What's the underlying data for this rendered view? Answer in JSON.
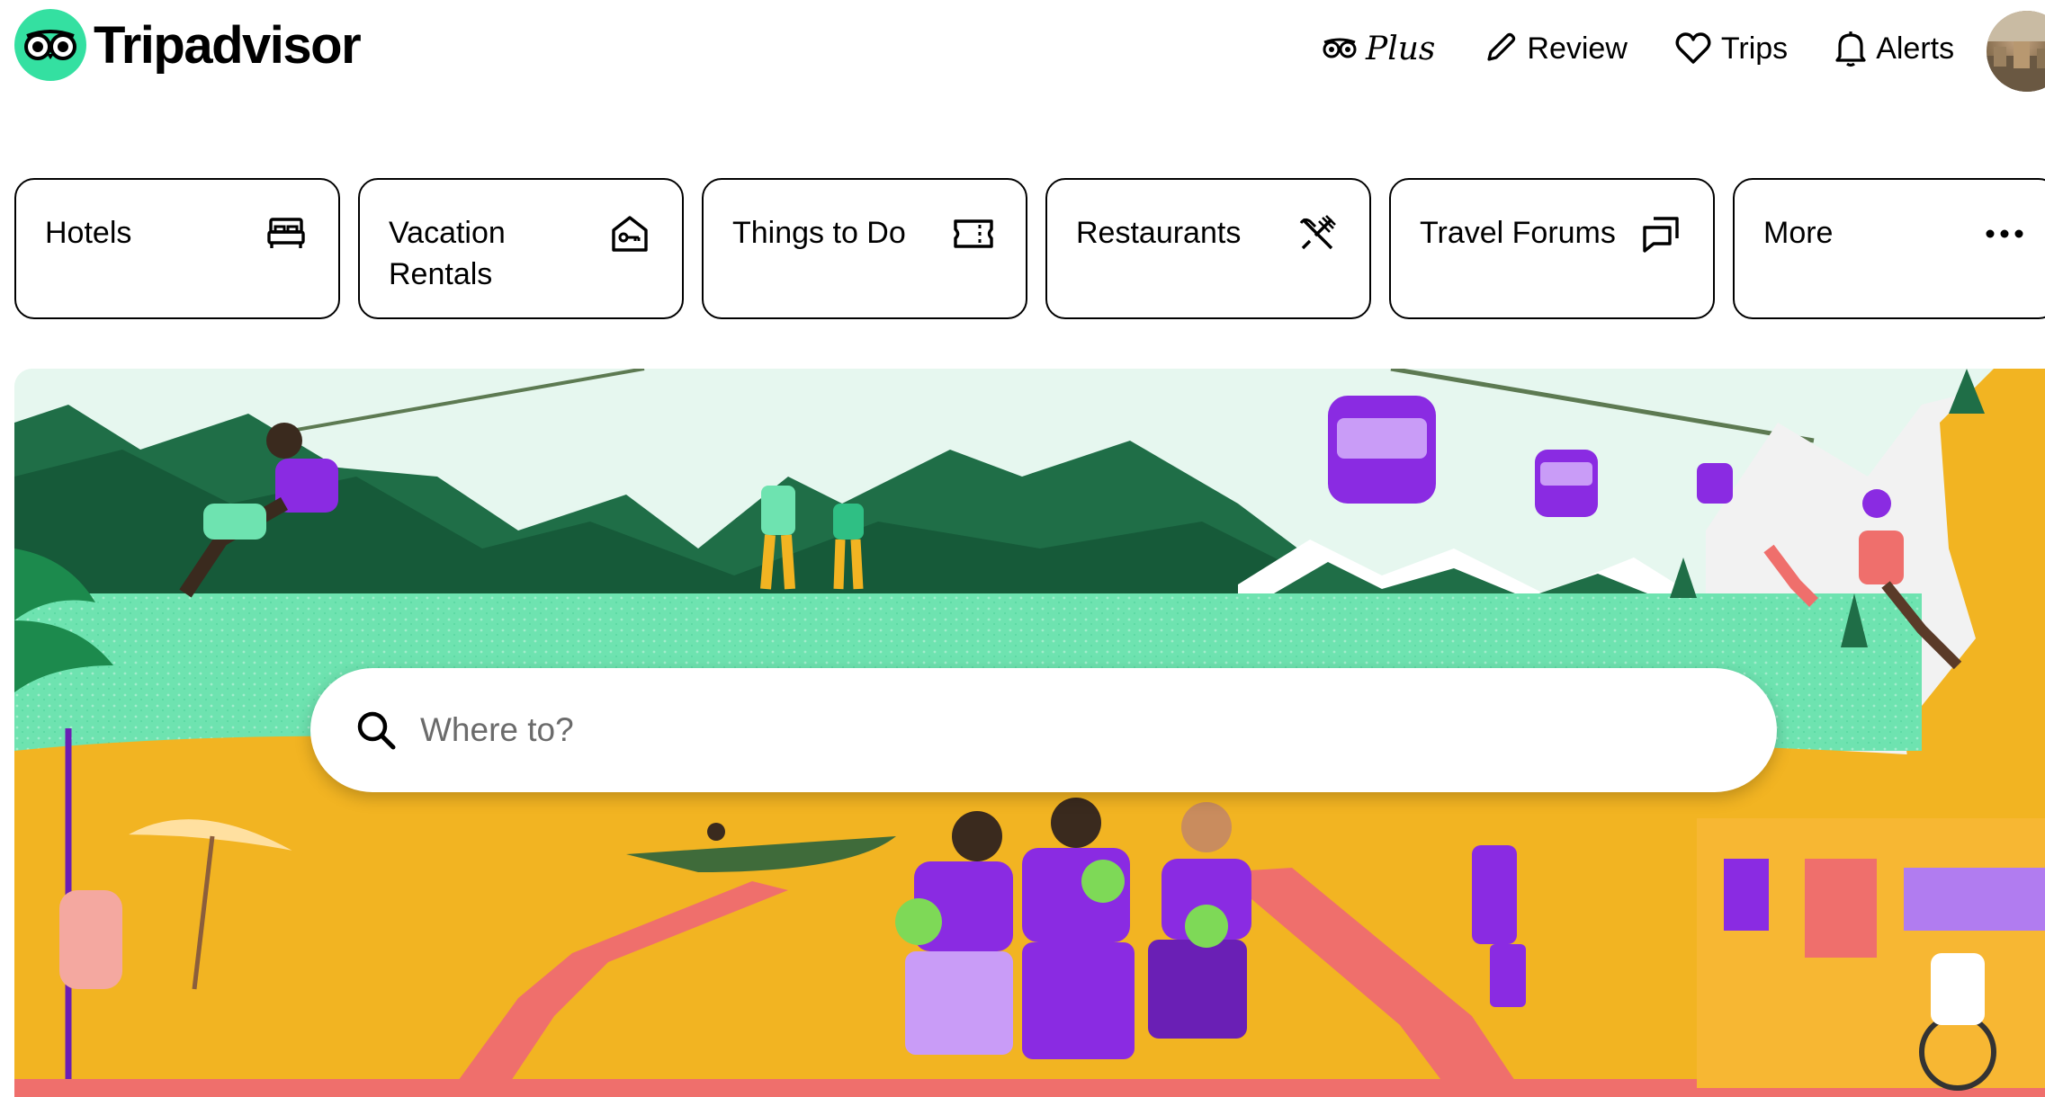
{
  "brand": {
    "name": "Tripadvisor",
    "color": "#34e0a1"
  },
  "nav": {
    "plus_label": "Plus",
    "review_label": "Review",
    "trips_label": "Trips",
    "alerts_label": "Alerts"
  },
  "categories": [
    {
      "label": "Hotels",
      "icon": "bed-icon"
    },
    {
      "label": "Vacation Rentals",
      "icon": "house-key-icon"
    },
    {
      "label": "Things to Do",
      "icon": "ticket-icon"
    },
    {
      "label": "Restaurants",
      "icon": "fork-knife-icon"
    },
    {
      "label": "Travel Forums",
      "icon": "chat-bubbles-icon"
    },
    {
      "label": "More",
      "icon": "more-dots-icon"
    }
  ],
  "search": {
    "placeholder": "Where to?"
  },
  "colors": {
    "mountain_green": "#1f6e47",
    "sand_yellow": "#f2b422",
    "sea_green": "#6ee3b0",
    "gondola_purple": "#8a2be2",
    "path_pink": "#ef6f6c"
  }
}
